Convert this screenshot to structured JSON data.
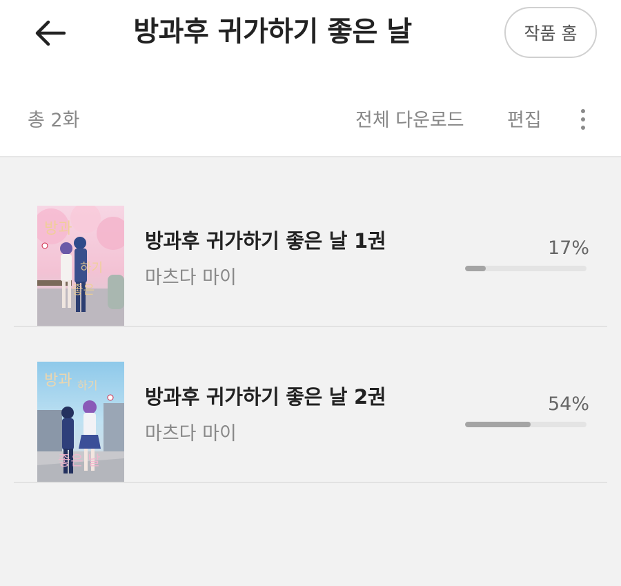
{
  "header": {
    "back_icon": "arrow-left-icon",
    "title": "방과후 귀가하기 좋은 날",
    "home_button": "작품 홈"
  },
  "toolbar": {
    "count": "총 2화",
    "download_all": "전체 다운로드",
    "edit": "편집",
    "more_icon": "more-vertical-icon"
  },
  "volumes": [
    {
      "title": "방과후 귀가하기 좋은 날 1권",
      "author": "마츠다 마이",
      "progress_label": "17%",
      "progress": 0.17
    },
    {
      "title": "방과후 귀가하기 좋은 날 2권",
      "author": "마츠다 마이",
      "progress_label": "54%",
      "progress": 0.54
    }
  ],
  "colors": {
    "title_text": "#222222",
    "secondary_text": "#888888",
    "progress_fill": "#a4a4a4",
    "progress_track": "#e4e4e4",
    "list_background": "#f2f2f2"
  }
}
